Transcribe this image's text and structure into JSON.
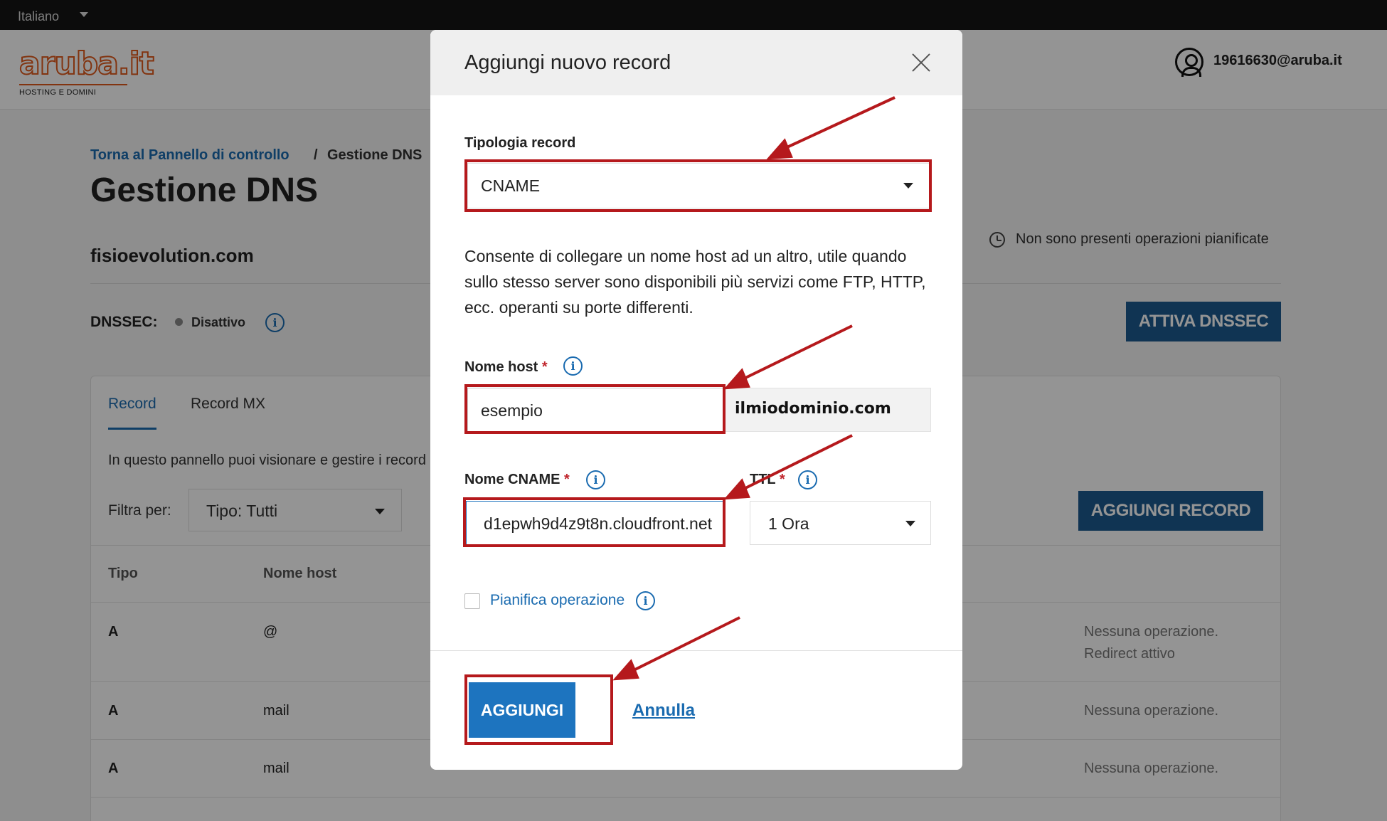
{
  "topbar": {
    "language": "Italiano"
  },
  "header": {
    "logo_text": "aruba.it",
    "logo_subtitle": "HOSTING E DOMINI",
    "user_email": "19616630@aruba.it"
  },
  "breadcrumb": {
    "back_link": "Torna al Pannello di controllo",
    "separator": "/",
    "current": "Gestione DNS"
  },
  "page": {
    "title": "Gestione DNS",
    "domain": "fisioevolution.com",
    "scheduled_status": "Non sono presenti operazioni pianificate",
    "dnssec_label": "DNSSEC:",
    "dnssec_status": "Disattivo",
    "dnssec_button": "ATTIVA DNSSEC"
  },
  "panel": {
    "tabs": [
      "Record",
      "Record MX"
    ],
    "description": "In questo pannello puoi visionare e gestire i record",
    "filter_label": "Filtra per:",
    "filter_value": "Tipo: Tutti",
    "add_button": "AGGIUNGI RECORD",
    "columns": [
      "Tipo",
      "Nome host"
    ],
    "rows": [
      {
        "type": "A",
        "host": "@",
        "op1": "Nessuna operazione.",
        "op2": "Redirect attivo"
      },
      {
        "type": "A",
        "host": "mail",
        "op1": "Nessuna operazione."
      },
      {
        "type": "A",
        "host": "mail",
        "op1": "Nessuna operazione."
      }
    ]
  },
  "modal": {
    "title": "Aggiungi nuovo record",
    "type_label": "Tipologia record",
    "type_value": "CNAME",
    "type_description": "Consente di collegare un nome host ad un altro, utile quando sullo stesso server sono disponibili più servizi come FTP, HTTP, ecc. operanti su porte differenti.",
    "host_label": "Nome host",
    "host_value": "esempio",
    "host_suffix": "ilmiodominio.com",
    "cname_label": "Nome CNAME",
    "cname_value": "d1epwh9d4z9t8n.cloudfront.net",
    "ttl_label": "TTL",
    "ttl_value": "1 Ora",
    "required_mark": "*",
    "schedule_label": "Pianifica operazione",
    "submit_button": "AGGIUNGI",
    "cancel_link": "Annulla"
  },
  "colors": {
    "brand_orange": "#e05a1c",
    "primary_blue": "#1d5b8f",
    "link_blue": "#1a6bb0",
    "highlight_red": "#b5191c"
  }
}
